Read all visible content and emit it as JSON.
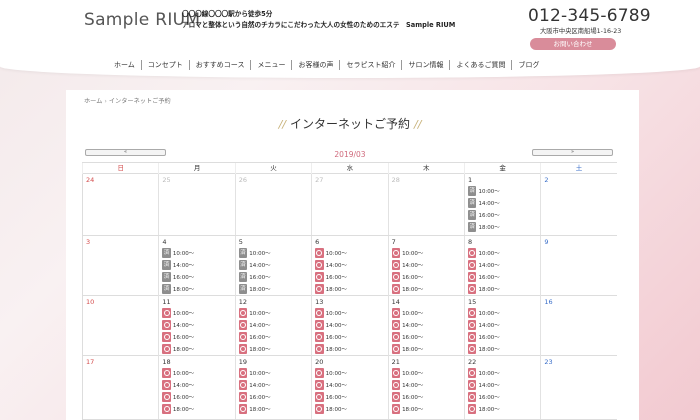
{
  "header": {
    "logo": "Sample RIUM",
    "catch_line1": "〇〇〇線〇〇〇駅から徒歩5分",
    "catch_line2": "アロマと整体という自然のチカラにこだわった大人の女性のためのエステ　Sample RIUM",
    "tel": "012-345-6789",
    "address": "大阪市中央区南船場1-16-23",
    "inquiry": "お問い合わせ"
  },
  "nav": {
    "items": [
      "ホーム",
      "コンセプト",
      "おすすめコース",
      "メニュー",
      "お客様の声",
      "セラピスト紹介",
      "サロン情報",
      "よくあるご質問",
      "ブログ"
    ]
  },
  "breadcrumb": {
    "home": "ホーム",
    "sep": "›",
    "current": "インターネットご予約"
  },
  "page": {
    "title": "インターネットご予約",
    "title_deco_left": "//",
    "title_deco_right": "//"
  },
  "calendar": {
    "prev": "«",
    "next": "»",
    "year_month": "2019/03",
    "dow": [
      "日",
      "月",
      "火",
      "水",
      "木",
      "金",
      "土"
    ],
    "closed_label": "済",
    "weeks": [
      [
        {
          "d": "24",
          "other": true
        },
        {
          "d": "25",
          "other": true
        },
        {
          "d": "26",
          "other": true
        },
        {
          "d": "27",
          "other": true
        },
        {
          "d": "28",
          "other": true
        },
        {
          "d": "1",
          "slots": [
            [
              "x",
              "10:00〜"
            ],
            [
              "x",
              "14:00〜"
            ],
            [
              "x",
              "16:00〜"
            ],
            [
              "x",
              "18:00〜"
            ]
          ]
        },
        {
          "d": "2"
        }
      ],
      [
        {
          "d": "3"
        },
        {
          "d": "4",
          "slots": [
            [
              "x",
              "10:00〜"
            ],
            [
              "x",
              "14:00〜"
            ],
            [
              "x",
              "16:00〜"
            ],
            [
              "x",
              "18:00〜"
            ]
          ]
        },
        {
          "d": "5",
          "slots": [
            [
              "x",
              "10:00〜"
            ],
            [
              "x",
              "14:00〜"
            ],
            [
              "x",
              "16:00〜"
            ],
            [
              "x",
              "18:00〜"
            ]
          ]
        },
        {
          "d": "6",
          "slots": [
            [
              "o",
              "10:00〜"
            ],
            [
              "o",
              "14:00〜"
            ],
            [
              "o",
              "16:00〜"
            ],
            [
              "o",
              "18:00〜"
            ]
          ]
        },
        {
          "d": "7",
          "slots": [
            [
              "o",
              "10:00〜"
            ],
            [
              "o",
              "14:00〜"
            ],
            [
              "o",
              "16:00〜"
            ],
            [
              "o",
              "18:00〜"
            ]
          ]
        },
        {
          "d": "8",
          "slots": [
            [
              "o",
              "10:00〜"
            ],
            [
              "o",
              "14:00〜"
            ],
            [
              "o",
              "16:00〜"
            ],
            [
              "o",
              "18:00〜"
            ]
          ]
        },
        {
          "d": "9"
        }
      ],
      [
        {
          "d": "10"
        },
        {
          "d": "11",
          "slots": [
            [
              "o",
              "10:00〜"
            ],
            [
              "o",
              "14:00〜"
            ],
            [
              "o",
              "16:00〜"
            ],
            [
              "o",
              "18:00〜"
            ]
          ]
        },
        {
          "d": "12",
          "slots": [
            [
              "o",
              "10:00〜"
            ],
            [
              "o",
              "14:00〜"
            ],
            [
              "o",
              "16:00〜"
            ],
            [
              "o",
              "18:00〜"
            ]
          ]
        },
        {
          "d": "13",
          "slots": [
            [
              "o",
              "10:00〜"
            ],
            [
              "o",
              "14:00〜"
            ],
            [
              "o",
              "16:00〜"
            ],
            [
              "o",
              "18:00〜"
            ]
          ]
        },
        {
          "d": "14",
          "slots": [
            [
              "o",
              "10:00〜"
            ],
            [
              "o",
              "14:00〜"
            ],
            [
              "o",
              "16:00〜"
            ],
            [
              "o",
              "18:00〜"
            ]
          ]
        },
        {
          "d": "15",
          "slots": [
            [
              "o",
              "10:00〜"
            ],
            [
              "o",
              "14:00〜"
            ],
            [
              "o",
              "16:00〜"
            ],
            [
              "o",
              "18:00〜"
            ]
          ]
        },
        {
          "d": "16"
        }
      ],
      [
        {
          "d": "17"
        },
        {
          "d": "18",
          "slots": [
            [
              "o",
              "10:00〜"
            ],
            [
              "o",
              "14:00〜"
            ],
            [
              "o",
              "16:00〜"
            ],
            [
              "o",
              "18:00〜"
            ]
          ]
        },
        {
          "d": "19",
          "slots": [
            [
              "o",
              "10:00〜"
            ],
            [
              "o",
              "14:00〜"
            ],
            [
              "o",
              "16:00〜"
            ],
            [
              "o",
              "18:00〜"
            ]
          ]
        },
        {
          "d": "20",
          "slots": [
            [
              "o",
              "10:00〜"
            ],
            [
              "o",
              "14:00〜"
            ],
            [
              "o",
              "16:00〜"
            ],
            [
              "o",
              "18:00〜"
            ]
          ]
        },
        {
          "d": "21",
          "slots": [
            [
              "o",
              "10:00〜"
            ],
            [
              "o",
              "14:00〜"
            ],
            [
              "o",
              "16:00〜"
            ],
            [
              "o",
              "18:00〜"
            ]
          ]
        },
        {
          "d": "22",
          "slots": [
            [
              "o",
              "10:00〜"
            ],
            [
              "o",
              "14:00〜"
            ],
            [
              "o",
              "16:00〜"
            ],
            [
              "o",
              "18:00〜"
            ]
          ]
        },
        {
          "d": "23"
        }
      ]
    ]
  },
  "colors": {
    "accent": "#d8707f",
    "sunday": "#d34a4a",
    "saturday": "#3b6fc9"
  }
}
